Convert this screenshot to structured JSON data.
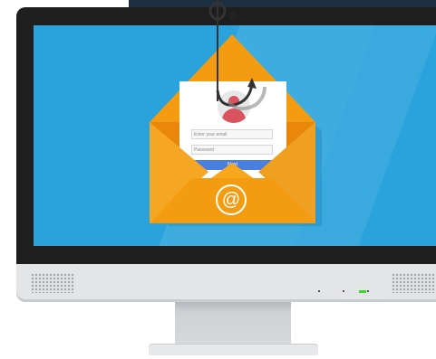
{
  "login_form": {
    "email_placeholder": "Enter your email",
    "password_placeholder": "Password",
    "next_label": "Next"
  },
  "envelope": {
    "at_symbol": "@"
  },
  "icons": [
    "fishing-hook-icon",
    "user-avatar-icon",
    "at-sign-icon",
    "speaker-grille-icon"
  ],
  "colors": {
    "screen": "#2aa3dc",
    "envelope_orange": "#f39c12",
    "button_blue": "#4a7fe2",
    "avatar_red": "#d9535f",
    "led_green": "#38d62c",
    "bezel": "#1e1e1e"
  }
}
